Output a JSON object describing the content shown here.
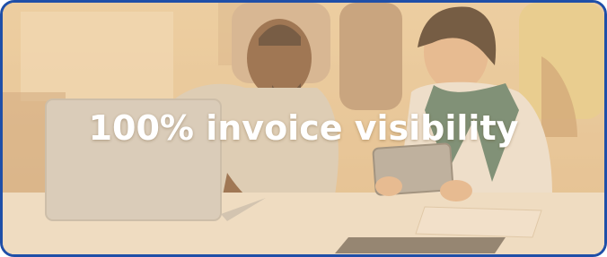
{
  "banner": {
    "headline": "100% invoice visibility",
    "border_color": "#1f4fa8",
    "overlay_tint": "#e8c797"
  },
  "scene": {
    "subjects": [
      "man-at-laptop",
      "woman-with-tablet",
      "standing-colleagues"
    ],
    "objects": [
      "laptop",
      "tablet",
      "desk",
      "papers"
    ]
  }
}
